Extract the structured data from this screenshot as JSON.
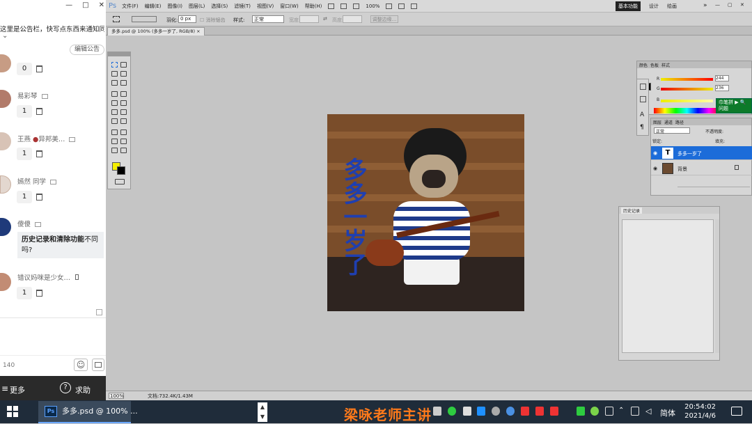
{
  "chat": {
    "notice": "这里是公告栏，快写点东西来通知同",
    "notice_chevron": "⌄",
    "edit_notice": "编辑公告",
    "entries": [
      {
        "name": "",
        "badge": "",
        "count": "0"
      },
      {
        "name": "易彩琴",
        "badge": "",
        "count": "1"
      },
      {
        "name": "王燕",
        "badge": "异邦美…",
        "count": "1"
      },
      {
        "name": "嫣然 同学",
        "badge": "",
        "count": "1"
      },
      {
        "name": "傻傻",
        "badge": "",
        "count": ""
      },
      {
        "name": "错议妈咪是少女…",
        "badge": "",
        "count": "1"
      }
    ],
    "question_bold": "历史记录和清除功能",
    "question_rest": "不同吗?",
    "input_count": "140",
    "footer_more": "更多",
    "footer_help": "求助"
  },
  "ps": {
    "logo": "Ps",
    "menus": [
      "文件(F)",
      "编辑(E)",
      "图像(I)",
      "图层(L)",
      "选择(S)",
      "滤镜(T)",
      "视图(V)",
      "窗口(W)",
      "帮助(H)"
    ],
    "zoom_menu": "100%",
    "workspace_button": "基本功能",
    "workspace_items": [
      "设计",
      "绘画"
    ],
    "feather_label": "羽化:",
    "feather_value": "0 px",
    "antialias_label": "消除锯齿",
    "style_label": "样式:",
    "style_value": "正常",
    "width_label": "宽度:",
    "height_label": "高度:",
    "refine_edge": "调整边缘...",
    "doc_tab": "多多.psd @ 100% (多多一岁了, RGB/8) ×",
    "canvas_text_vertical": "多多一岁了",
    "color_panel": {
      "tabs": [
        "颜色",
        "色板",
        "样式"
      ],
      "r": "244",
      "g": "236",
      "b": "",
      "r_label": "R",
      "g_label": "G",
      "b_label": "B"
    },
    "layers_panel": {
      "tabs": [
        "图层",
        "通道",
        "路径"
      ],
      "blend_mode": "正常",
      "opacity_label": "不透明度:",
      "lock_label": "锁定:",
      "fill_label": "填充:",
      "layers": [
        {
          "name": "多多一岁了",
          "type": "T",
          "selected": true
        },
        {
          "name": "背景",
          "type": "image",
          "selected": false
        }
      ]
    },
    "history_panel": {
      "tab": "历史记录"
    },
    "status_zoom": "100%",
    "status_doc": "文档:732.4K/1.43M",
    "overlay_badge": "巾笔拼 ▶ 🔍 问题"
  },
  "taskbar": {
    "app_label": "多多.psd @ 100% ...",
    "ps_icon_text": "Ps",
    "watermark": "梁咏老师主讲",
    "ime": "简体",
    "time": "20:54:02",
    "date": "2021/4/6"
  },
  "colors": {
    "fg": "#f5ef00",
    "bg": "#000000",
    "selection": "#1c6cd9",
    "canvas_text": "#1f3fb0",
    "watermark": "#ff7a1a"
  }
}
